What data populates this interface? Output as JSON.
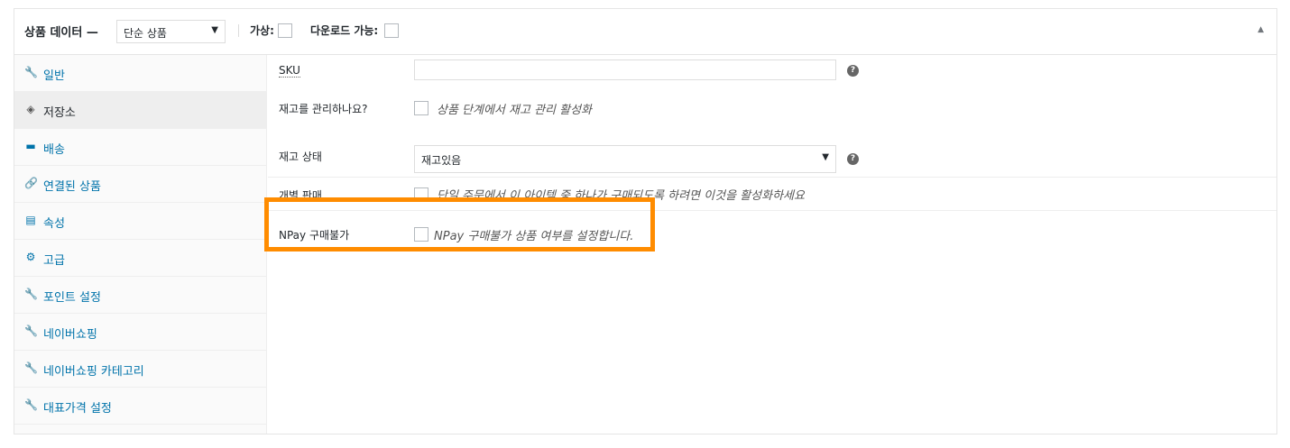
{
  "header": {
    "title": "상품 데이터 —",
    "product_type": "단순 상품",
    "virtual_label": "가상:",
    "downloadable_label": "다운로드 가능:",
    "collapse_glyph": "▲",
    "dropdown_glyph": "▼"
  },
  "sidebar": {
    "items": [
      {
        "label": "일반",
        "icon": "wrench-icon",
        "glyph": "🔧"
      },
      {
        "label": "저장소",
        "icon": "tag-icon",
        "glyph": "◈"
      },
      {
        "label": "배송",
        "icon": "truck-icon",
        "glyph": "▬"
      },
      {
        "label": "연결된 상품",
        "icon": "link-icon",
        "glyph": "🔗"
      },
      {
        "label": "속성",
        "icon": "list-icon",
        "glyph": "▤"
      },
      {
        "label": "고급",
        "icon": "gear-icon",
        "glyph": "⚙"
      },
      {
        "label": "포인트 설정",
        "icon": "wrench-icon",
        "glyph": "🔧"
      },
      {
        "label": "네이버쇼핑",
        "icon": "wrench-icon",
        "glyph": "🔧"
      },
      {
        "label": "네이버쇼핑 카테고리",
        "icon": "wrench-icon",
        "glyph": "🔧"
      },
      {
        "label": "대표가격 설정",
        "icon": "wrench-icon",
        "glyph": "🔧"
      }
    ],
    "active_index": 1
  },
  "inventory": {
    "sku_label": "SKU",
    "sku_value": "",
    "manage_label": "재고를 관리하나요?",
    "manage_desc": "상품 단계에서 재고 관리 활성화",
    "status_label": "재고 상태",
    "status_value": "재고있음",
    "sold_individually_label": "개별 판매",
    "sold_individually_desc": "단일 주문에서 이 아이템 중 하나가 구매되도록 하려면 이것을 활성화하세요",
    "npay_label": "NPay 구매불가",
    "npay_desc": "NPay 구매불가 상품 여부를 설정합니다.",
    "help_glyph": "?"
  },
  "colors": {
    "link": "#0073aa",
    "highlight": "#ff8c00",
    "active_tab_bg": "#eeeeee"
  }
}
